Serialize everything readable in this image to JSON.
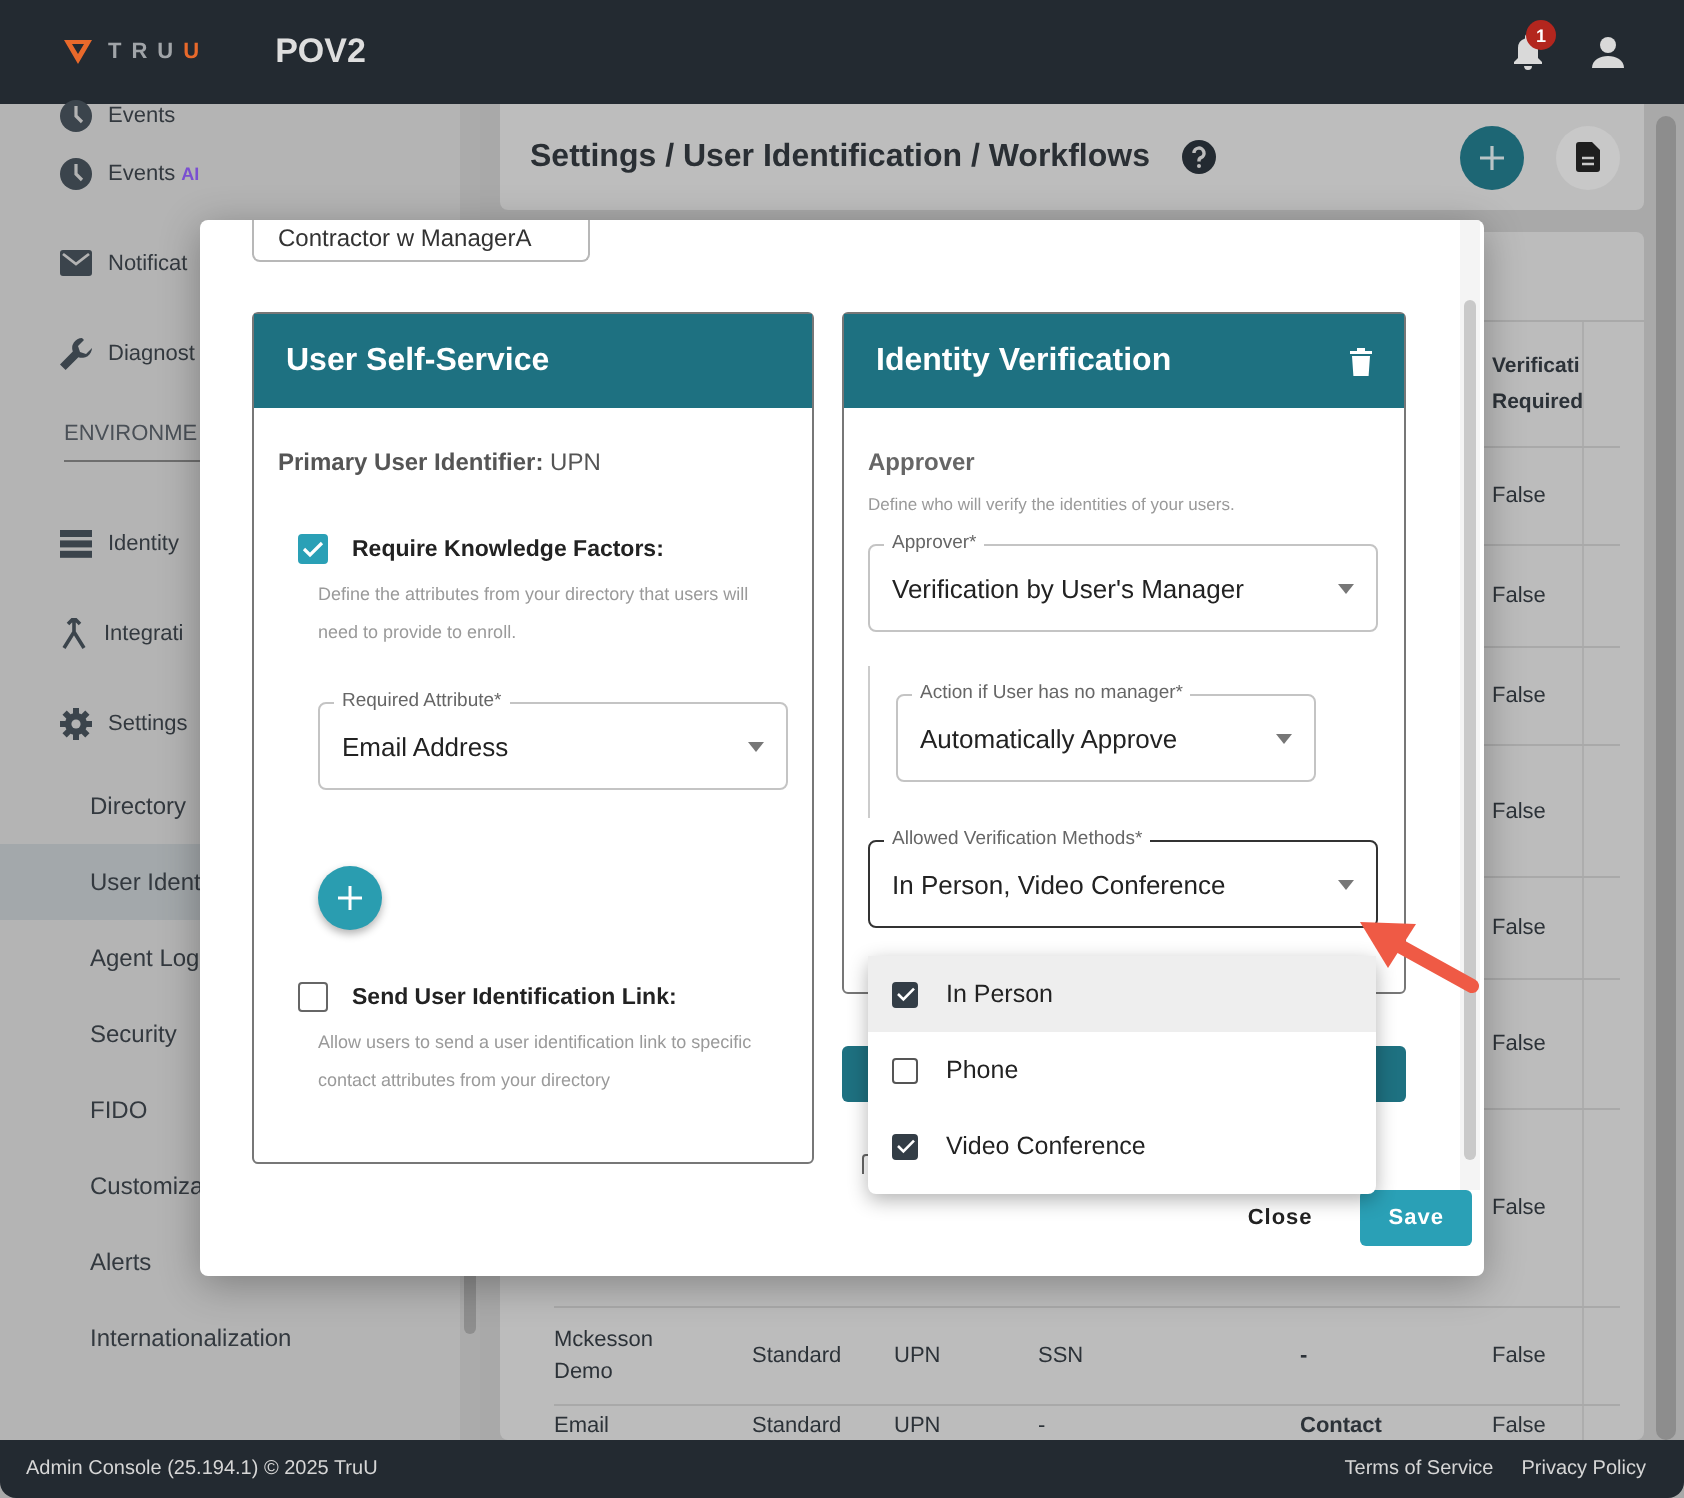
{
  "header": {
    "logo": {
      "text": "TRU",
      "accent": "U"
    },
    "title": "POV2",
    "notifications": "1"
  },
  "sidebar": {
    "items": [
      {
        "kind": "item",
        "label": "Events"
      },
      {
        "kind": "item",
        "label": "Events",
        "badge": "AI"
      },
      {
        "kind": "item",
        "label": "Notificat"
      },
      {
        "kind": "item",
        "label": "Diagnost"
      },
      {
        "kind": "section",
        "label": "ENVIRONME"
      },
      {
        "kind": "item",
        "label": "Identity"
      },
      {
        "kind": "item",
        "label": "Integrati"
      },
      {
        "kind": "item",
        "label": "Settings",
        "children": [
          {
            "label": "Directory",
            "selected": false
          },
          {
            "label": "User Ident",
            "selected": true
          },
          {
            "label": "Agent Log",
            "selected": false
          },
          {
            "label": "Security",
            "selected": false
          },
          {
            "label": "FIDO",
            "selected": false
          },
          {
            "label": "Customiza",
            "selected": false
          },
          {
            "label": "Alerts",
            "selected": false
          },
          {
            "label": "Internationalization",
            "selected": false
          }
        ]
      }
    ]
  },
  "page": {
    "breadcrumb": "Settings / User Identification / Workflows"
  },
  "table": {
    "verification_header": "Verificati Required",
    "rows": [
      {
        "verification": "False"
      },
      {
        "verification": "False"
      },
      {
        "verification": "False"
      },
      {
        "verification": "False"
      },
      {
        "verification": "False"
      },
      {
        "verification": "False"
      },
      {
        "verification": "False"
      },
      {
        "name": "Mckesson Demo",
        "type": "Standard",
        "identifier": "UPN",
        "column_4": "SSN",
        "column_5": "-",
        "verification": "False"
      },
      {
        "name": "Email",
        "type": "Standard",
        "identifier": "UPN",
        "column_4": "-",
        "column_5": "Contact",
        "verification": "False"
      }
    ]
  },
  "modal": {
    "top_field": {
      "value": "Contractor w ManagerA"
    },
    "self_service": {
      "title": "User Self-Service",
      "primary": "**Primary User Identifier:** UPN",
      "knowledge": {
        "label": "Require Knowledge Factors:",
        "checked": true,
        "help": "Define the attributes from your directory that users will need to provide to enroll."
      },
      "attribute_field": {
        "label": "Required Attribute*",
        "value": "Email Address"
      },
      "link": {
        "label": "Send User Identification Link:",
        "checked": false,
        "help": "Allow users to send a user identification link to specific contact attributes from your directory"
      }
    },
    "identity": {
      "title": "Identity Verification",
      "section": "Approver",
      "help": "Define who will verify the identities of your users.",
      "approver": {
        "label": "Approver*",
        "value": "Verification by User's Manager"
      },
      "no_manager": {
        "label": "Action if User has no manager*",
        "value": "Automatically Approve"
      },
      "methods": {
        "label": "Allowed Verification Methods*",
        "value": "In Person, Video Conference",
        "expanded": true
      }
    },
    "hidden_checkbox": {
      "checked": false
    },
    "options": [
      {
        "label": "In Person",
        "checked": true,
        "selected": true
      },
      {
        "label": "Phone",
        "checked": false,
        "selected": false
      },
      {
        "label": "Video Conference",
        "checked": true,
        "selected": false
      }
    ],
    "buttons": {
      "close": "Close",
      "save": "Save"
    }
  },
  "footer": {
    "left": "Admin Console (25.194.1) © 2025 TruU",
    "links": [
      "Terms of Service",
      "Privacy Policy"
    ]
  }
}
